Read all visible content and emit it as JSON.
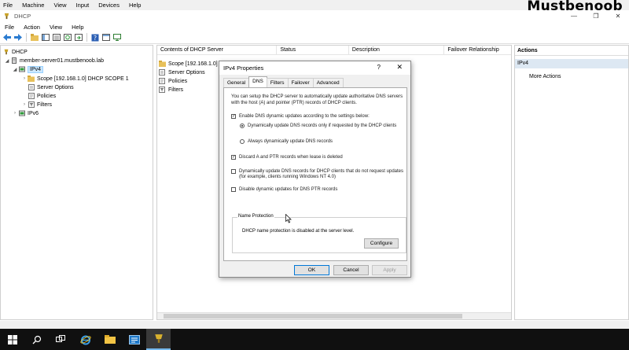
{
  "vm_menu": [
    "File",
    "Machine",
    "View",
    "Input",
    "Devices",
    "Help"
  ],
  "watermark": "Mustbenoob",
  "window": {
    "title": "DHCP",
    "minimize": "—",
    "restore": "❐",
    "close": "✕"
  },
  "app_menu": [
    "File",
    "Action",
    "View",
    "Help"
  ],
  "tree": {
    "root": "DHCP",
    "server": "member-server01.mustbenoob.lab",
    "ipv4": "IPv4",
    "scope": "Scope [192.168.1.0] DHCP SCOPE 1",
    "server_options": "Server Options",
    "policies": "Policies",
    "filters": "Filters",
    "ipv6": "IPv6"
  },
  "list": {
    "columns": [
      "Contents of DHCP Server",
      "Status",
      "Description",
      "Failover Relationship"
    ],
    "rows": [
      "Scope [192.168.1.0]",
      "Server Options",
      "Policies",
      "Filters"
    ]
  },
  "actions": {
    "title": "Actions",
    "section": "IPv4",
    "more": "More Actions"
  },
  "dialog": {
    "title": "IPv4 Properties",
    "help": "?",
    "close": "✕",
    "tabs": [
      "General",
      "DNS",
      "Filters",
      "Failover",
      "Advanced"
    ],
    "intro": "You can setup the DHCP server to automatically update authoritative DNS servers with the host (A) and pointer (PTR) records of DHCP clients.",
    "enable_dns": "Enable DNS dynamic updates according to the settings below:",
    "radio_requested": "Dynamically update DNS records only if requested by the DHCP clients",
    "radio_always": "Always dynamically update DNS records",
    "discard": "Discard A and PTR records when lease is deleted",
    "nt4": "Dynamically update DNS records for DHCP clients that do not request updates (for example, clients running Windows NT 4.0)",
    "disable_ptr": "Disable dynamic updates for DNS PTR records",
    "name_protection_title": "Name Protection",
    "name_protection_text": "DHCP name protection is disabled at the server level.",
    "configure": "Configure",
    "ok": "OK",
    "cancel": "Cancel",
    "apply": "Apply",
    "checked": {
      "enable_dns": true,
      "radio": "requested",
      "discard": true,
      "nt4": false,
      "disable_ptr": false
    }
  },
  "colors": {
    "selection": "#cce8ff",
    "taskbar": "#101010",
    "accent": "#0078d7"
  }
}
